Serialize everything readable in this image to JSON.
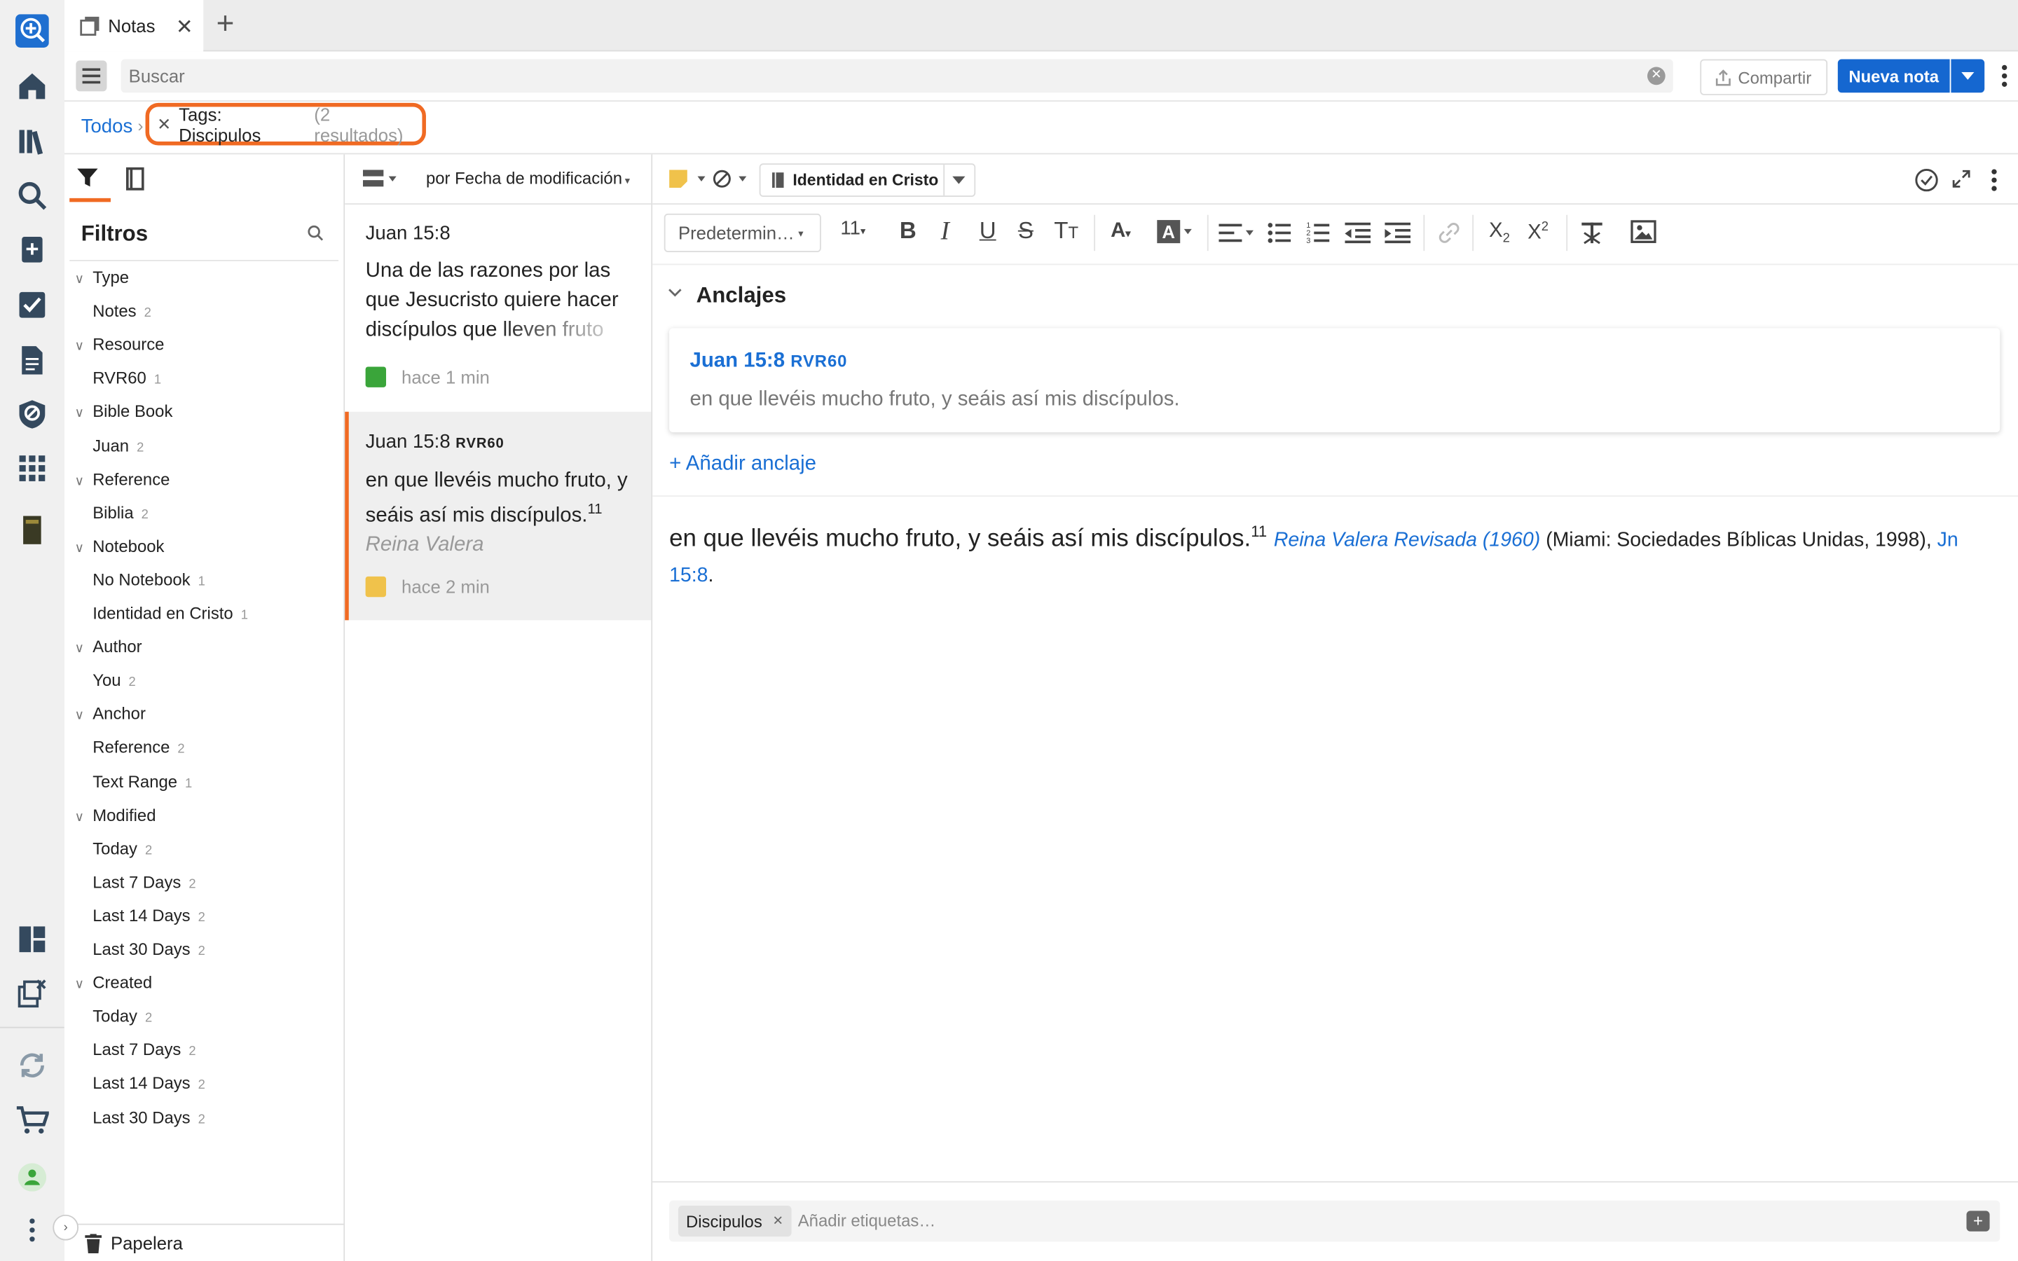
{
  "tab": {
    "title": "Notas"
  },
  "toolbar": {
    "search_placeholder": "Buscar",
    "share_label": "Compartir",
    "new_note_label": "Nueva nota"
  },
  "breadcrumb": {
    "root": "Todos",
    "filter_label": "Tags: Discipulos",
    "filter_count": "(2 resultados)"
  },
  "filters": {
    "title": "Filtros",
    "trash_label": "Papelera",
    "groups": [
      {
        "label": "Type",
        "items": [
          {
            "label": "Notes",
            "count": "2"
          }
        ]
      },
      {
        "label": "Resource",
        "items": [
          {
            "label": "RVR60",
            "count": "1"
          }
        ]
      },
      {
        "label": "Bible Book",
        "items": [
          {
            "label": "Juan",
            "count": "2"
          }
        ]
      },
      {
        "label": "Reference",
        "items": [
          {
            "label": "Biblia",
            "count": "2"
          }
        ]
      },
      {
        "label": "Notebook",
        "items": [
          {
            "label": "No Notebook",
            "count": "1"
          },
          {
            "label": "Identidad en Cristo",
            "count": "1"
          }
        ]
      },
      {
        "label": "Author",
        "items": [
          {
            "label": "You",
            "count": "2"
          }
        ]
      },
      {
        "label": "Anchor",
        "items": [
          {
            "label": "Reference",
            "count": "2"
          },
          {
            "label": "Text Range",
            "count": "1"
          }
        ]
      },
      {
        "label": "Modified",
        "items": [
          {
            "label": "Today",
            "count": "2"
          },
          {
            "label": "Last 7 Days",
            "count": "2"
          },
          {
            "label": "Last 14 Days",
            "count": "2"
          },
          {
            "label": "Last 30 Days",
            "count": "2"
          }
        ]
      },
      {
        "label": "Created",
        "items": [
          {
            "label": "Today",
            "count": "2"
          },
          {
            "label": "Last 7 Days",
            "count": "2"
          },
          {
            "label": "Last 14 Days",
            "count": "2"
          },
          {
            "label": "Last 30 Days",
            "count": "2"
          }
        ]
      }
    ]
  },
  "notelist": {
    "sort_label": "por Fecha de modificación",
    "notes": [
      {
        "ref": "Juan 15:8",
        "version": "",
        "body": "Una de las razones por las que Jesucristo quiere hacer discípulos que lleven fruto",
        "time": "hace 1 min",
        "color": "#3aa53a"
      },
      {
        "ref": "Juan 15:8",
        "version": "RVR60",
        "body": "en que llevéis mucho fruto, y seáis así mis discípulos.",
        "body_sup": "11",
        "body_cite": "Reina Valera",
        "time": "hace 2 min",
        "color": "#f0c24b"
      }
    ]
  },
  "editor": {
    "notebook": "Identidad en Cristo",
    "font_select": "Predetermin…",
    "font_size": "11",
    "anchors_title": "Anclajes",
    "anchor_ref": "Juan 15:8",
    "anchor_version": "RVR60",
    "anchor_text": "en que llevéis mucho fruto, y seáis así mis discípulos.",
    "add_anchor": "+ Añadir anclaje",
    "content_text": "en que llevéis mucho fruto, y seáis así mis discípulos.",
    "content_sup": "11",
    "content_cite_title": "Reina Valera Revisada (1960)",
    "content_cite_rest": " (Miami: Sociedades Bíblicas Unidas, 1998), ",
    "content_cite_ref": "Jn 15:8",
    "content_end": ".",
    "tag_chip": "Discipulos",
    "tag_placeholder": "Añadir etiquetas…"
  },
  "colors": {
    "accent": "#1567d0",
    "highlight": "#f06a23"
  }
}
